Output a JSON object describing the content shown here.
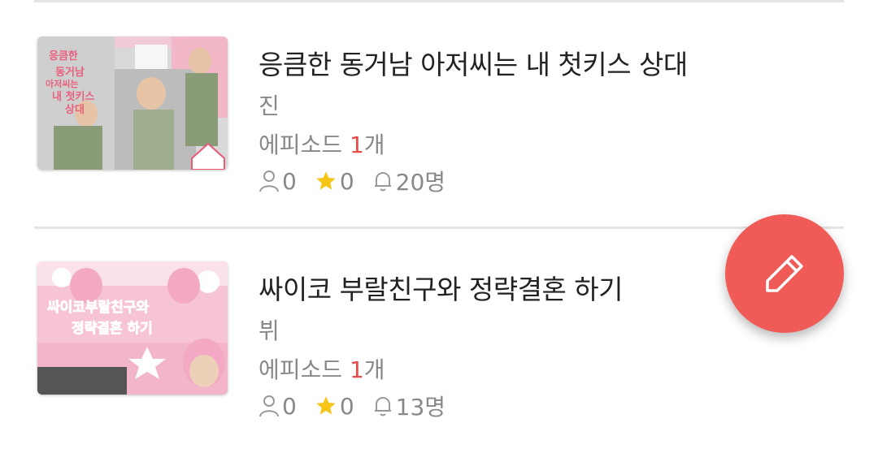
{
  "items": [
    {
      "title": "응큼한 동거남 아저씨는 내 첫키스 상대",
      "author": "진",
      "episodes_prefix": "에피소드 ",
      "episodes_count": "1",
      "episodes_suffix": "개",
      "readers": "0",
      "stars": "0",
      "subscribers": "20명",
      "cover_texts": [
        "응큼한",
        "동거남",
        "아저씨는",
        "내 첫키스",
        "상대"
      ],
      "cover_accent": "#e8617f"
    },
    {
      "title": "싸이코 부랄친구와 정략결혼 하기",
      "author": "뷔",
      "episodes_prefix": "에피소드 ",
      "episodes_count": "1",
      "episodes_suffix": "개",
      "readers": "0",
      "stars": "0",
      "subscribers": "13명",
      "cover_texts": [
        "싸이코부랄친구와",
        "정략결혼 하기"
      ],
      "cover_accent": "#f3a9c3"
    }
  ],
  "icons": {
    "reader": "person-icon",
    "star": "star-icon",
    "subscribe": "bell-icon",
    "fab": "pencil-icon"
  },
  "colors": {
    "accent_red": "#e84a4a",
    "fab": "#f05a57",
    "star": "#f5c518",
    "muted_text": "#888888"
  }
}
